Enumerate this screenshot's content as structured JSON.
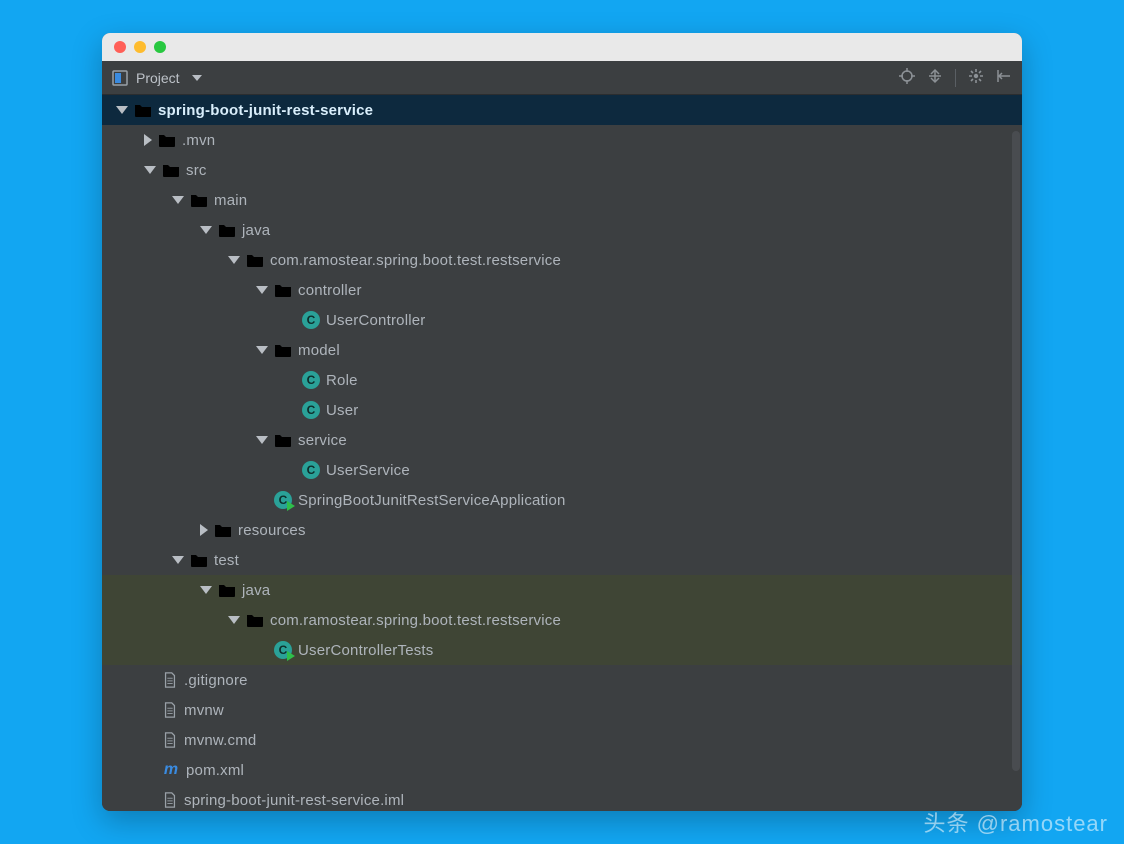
{
  "toolbar": {
    "title": "Project",
    "icons": [
      "target-icon",
      "autoscroll-icon",
      "gear-icon",
      "collapse-icon"
    ]
  },
  "tree": [
    {
      "depth": 0,
      "arrow": "down",
      "icon": "module",
      "label": "spring-boot-junit-rest-service",
      "selected": true
    },
    {
      "depth": 1,
      "arrow": "right",
      "icon": "folder",
      "label": ".mvn"
    },
    {
      "depth": 1,
      "arrow": "down",
      "icon": "folder",
      "label": "src"
    },
    {
      "depth": 2,
      "arrow": "down",
      "icon": "folder",
      "label": "main"
    },
    {
      "depth": 3,
      "arrow": "down",
      "icon": "folder-blue",
      "label": "java"
    },
    {
      "depth": 4,
      "arrow": "down",
      "icon": "folder",
      "label": "com.ramostear.spring.boot.test.restservice"
    },
    {
      "depth": 5,
      "arrow": "down",
      "icon": "folder",
      "label": "controller"
    },
    {
      "depth": 6,
      "arrow": "none",
      "icon": "class",
      "label": "UserController"
    },
    {
      "depth": 5,
      "arrow": "down",
      "icon": "folder",
      "label": "model"
    },
    {
      "depth": 6,
      "arrow": "none",
      "icon": "class",
      "label": "Role"
    },
    {
      "depth": 6,
      "arrow": "none",
      "icon": "class",
      "label": "User"
    },
    {
      "depth": 5,
      "arrow": "down",
      "icon": "folder",
      "label": "service"
    },
    {
      "depth": 6,
      "arrow": "none",
      "icon": "class",
      "label": "UserService"
    },
    {
      "depth": 5,
      "arrow": "none",
      "icon": "class-run",
      "label": "SpringBootJunitRestServiceApplication"
    },
    {
      "depth": 3,
      "arrow": "right",
      "icon": "folder-res",
      "label": "resources"
    },
    {
      "depth": 2,
      "arrow": "down",
      "icon": "folder",
      "label": "test"
    },
    {
      "depth": 3,
      "arrow": "down",
      "icon": "folder-blue",
      "label": "java",
      "hl": true
    },
    {
      "depth": 4,
      "arrow": "down",
      "icon": "folder",
      "label": "com.ramostear.spring.boot.test.restservice",
      "hl": true
    },
    {
      "depth": 5,
      "arrow": "none",
      "icon": "class-run",
      "label": "UserControllerTests",
      "hl": true
    },
    {
      "depth": 1,
      "arrow": "none",
      "icon": "file",
      "label": ".gitignore"
    },
    {
      "depth": 1,
      "arrow": "none",
      "icon": "file",
      "label": "mvnw"
    },
    {
      "depth": 1,
      "arrow": "none",
      "icon": "file",
      "label": "mvnw.cmd"
    },
    {
      "depth": 1,
      "arrow": "none",
      "icon": "pom",
      "label": "pom.xml"
    },
    {
      "depth": 1,
      "arrow": "none",
      "icon": "file",
      "label": "spring-boot-junit-rest-service.iml"
    }
  ],
  "watermark": "头条 @ramostear"
}
